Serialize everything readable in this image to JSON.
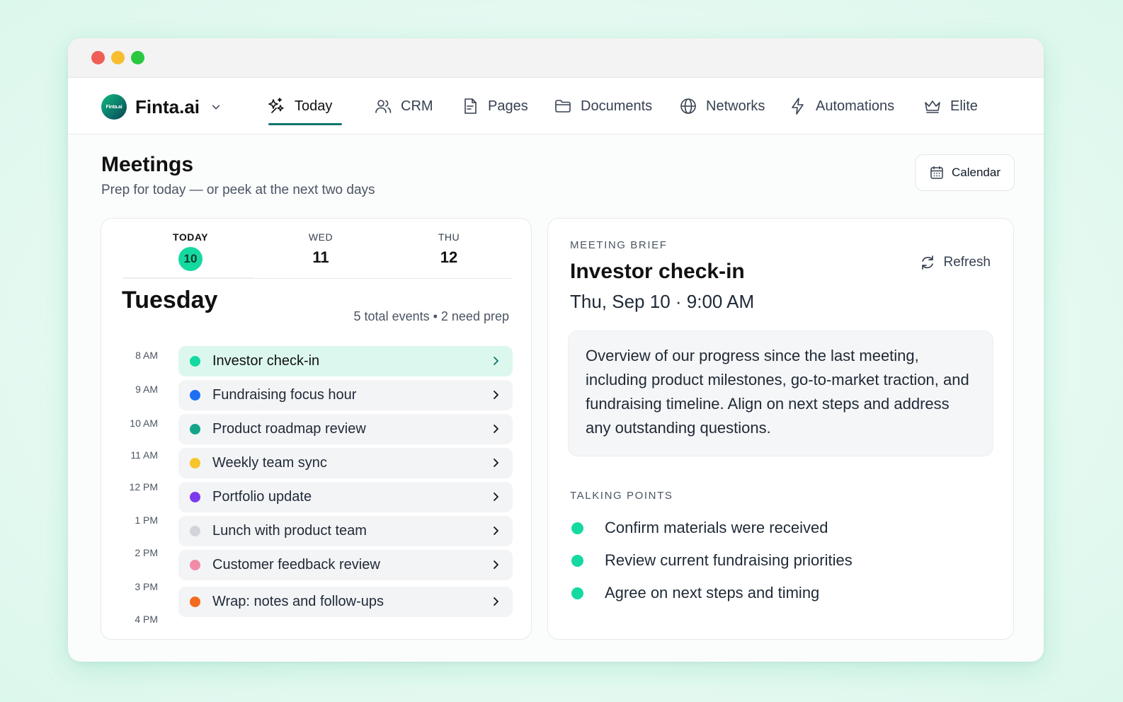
{
  "window": {
    "controls": {
      "close_color": "#ef5f57",
      "minimize_color": "#f7bd2f",
      "maximize_color": "#2ac840"
    }
  },
  "brand": {
    "logo_text": "Finta.ai",
    "name": "Finta.ai",
    "dropdown_icon": "chevron-down-icon"
  },
  "nav": {
    "tabs": [
      {
        "label": "Today",
        "icon": "sparkles-icon",
        "active": true
      },
      {
        "label": "CRM",
        "icon": "users-icon"
      },
      {
        "label": "Pages",
        "icon": "document-icon"
      },
      {
        "label": "Documents",
        "icon": "folder-icon"
      },
      {
        "label": "Networks",
        "icon": "globe-icon"
      },
      {
        "label": "Automations",
        "icon": "lightning-icon"
      },
      {
        "label": "Elite",
        "icon": "crown-icon"
      }
    ]
  },
  "page": {
    "title": "Meetings",
    "subtitle": "Prep for today — or peek at the next two days",
    "calendar_button": "Calendar"
  },
  "schedule": {
    "days": [
      {
        "label": "TODAY",
        "number": "10"
      },
      {
        "label": "WED",
        "number": "11"
      },
      {
        "label": "THU",
        "number": "12"
      }
    ],
    "weekday": "Tuesday",
    "summary": "5 total events • 2 need prep",
    "times": [
      "8 AM",
      "9 AM",
      "10 AM",
      "11 AM",
      "12 PM",
      "1 PM",
      "2 PM",
      "3 PM",
      "4 PM"
    ],
    "events": [
      {
        "title": "Investor check-in",
        "color": "#14d9a0",
        "selected": true
      },
      {
        "title": "Fundraising focus hour",
        "color": "#1d6ff2"
      },
      {
        "title": "Product roadmap review",
        "color": "#14a38b"
      },
      {
        "title": "Weekly team sync",
        "color": "#f7c52b"
      },
      {
        "title": "Portfolio update",
        "color": "#7c3aed"
      },
      {
        "title": "Lunch with product team",
        "color": "#d1d5db"
      },
      {
        "title": "Customer feedback review",
        "color": "#f08ca8"
      },
      {
        "title": "Wrap: notes and follow-ups",
        "color": "#f26b1d"
      }
    ]
  },
  "brief": {
    "kicker": "MEETING BRIEF",
    "title": "Investor check-in",
    "datetime": "Thu, Sep 10 · 9:00 AM",
    "refresh_label": "Refresh",
    "overview": "Overview of our progress since the last meeting, including product milestones, go-to-market traction, and fundraising timeline. Align on next steps and address any outstanding questions.",
    "talking_points_label": "TALKING POINTS",
    "talking_points": [
      "Confirm materials were received",
      "Review current fundraising priorities",
      "Agree on next steps and timing"
    ]
  },
  "colors": {
    "accent": "#14d9a0",
    "accent_dark": "#0f766e",
    "selected_bg": "#dcf8ee"
  }
}
